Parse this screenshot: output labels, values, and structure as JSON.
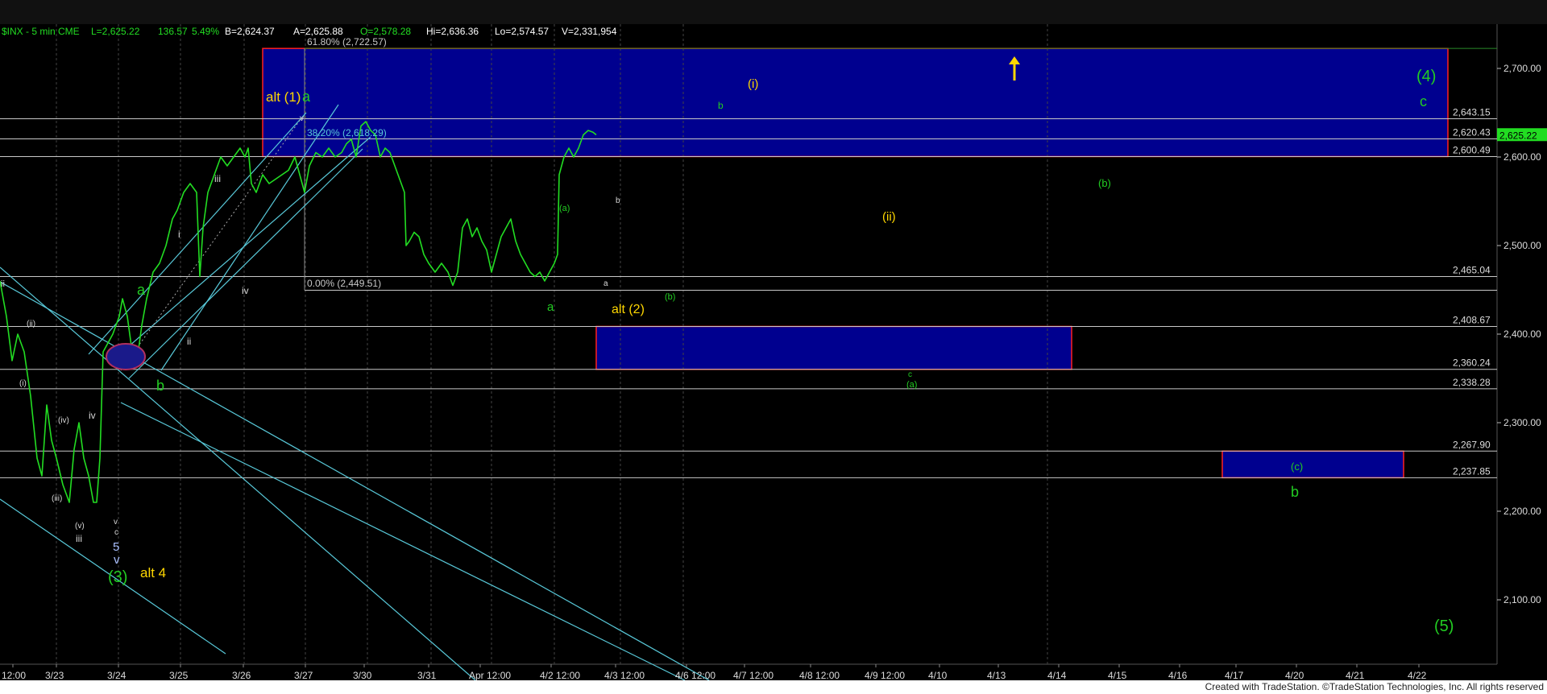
{
  "header": {
    "symbol": "$INX - 5 min  CME",
    "last": "L=2,625.22",
    "change": "136.57",
    "pct": "5.49%",
    "bid": "B=2,624.37",
    "ask": "A=2,625.88",
    "open": "O=2,578.28",
    "high": "Hi=2,636.36",
    "low": "Lo=2,574.57",
    "volume": "V=2,331,954"
  },
  "footer": {
    "credit": "Created with TradeStation. ©TradeStation Technologies, Inc. All rights reserved"
  },
  "colors": {
    "price": "#22dd22",
    "box_fill": "#00008f",
    "box_border": "#ff2020",
    "trendline": "#58c8d8",
    "hline": "#c8c8c8",
    "label_yellow": "#ffd700",
    "label_green": "#22cc22",
    "label_white": "#d8d8d8",
    "last_badge": "#22dd22"
  },
  "chart_data": {
    "type": "line",
    "series": [
      {
        "name": "",
        "note_points": [
          [
            0,
            2460
          ],
          [
            8,
            2420
          ],
          [
            15,
            2370
          ],
          [
            22,
            2400
          ],
          [
            30,
            2380
          ],
          [
            38,
            2330
          ],
          [
            46,
            2260
          ],
          [
            52,
            2240
          ],
          [
            58,
            2320
          ],
          [
            64,
            2280
          ],
          [
            70,
            2260
          ],
          [
            78,
            2230
          ],
          [
            86,
            2210
          ],
          [
            92,
            2270
          ],
          [
            98,
            2300
          ],
          [
            104,
            2260
          ],
          [
            110,
            2240
          ],
          [
            116,
            2210
          ],
          [
            120,
            2210
          ],
          [
            124,
            2260
          ],
          [
            128,
            2380
          ],
          [
            134,
            2390
          ],
          [
            140,
            2400
          ],
          [
            148,
            2420
          ],
          [
            152,
            2440
          ],
          [
            158,
            2420
          ],
          [
            164,
            2380
          ],
          [
            170,
            2370
          ],
          [
            176,
            2410
          ],
          [
            182,
            2440
          ],
          [
            190,
            2470
          ],
          [
            198,
            2480
          ],
          [
            206,
            2500
          ],
          [
            214,
            2530
          ],
          [
            220,
            2540
          ],
          [
            228,
            2560
          ],
          [
            236,
            2570
          ],
          [
            244,
            2560
          ],
          [
            248,
            2465
          ],
          [
            252,
            2520
          ],
          [
            258,
            2560
          ],
          [
            266,
            2580
          ],
          [
            274,
            2600
          ],
          [
            282,
            2590
          ],
          [
            290,
            2600
          ],
          [
            298,
            2610
          ],
          [
            304,
            2600
          ],
          [
            308,
            2610
          ],
          [
            312,
            2570
          ],
          [
            318,
            2560
          ],
          [
            326,
            2580
          ],
          [
            334,
            2570
          ],
          [
            342,
            2575
          ],
          [
            350,
            2580
          ],
          [
            358,
            2585
          ],
          [
            366,
            2600
          ],
          [
            372,
            2580
          ],
          [
            378,
            2560
          ],
          [
            384,
            2590
          ],
          [
            392,
            2605
          ],
          [
            400,
            2600
          ],
          [
            408,
            2610
          ],
          [
            416,
            2600
          ],
          [
            424,
            2605
          ],
          [
            430,
            2615
          ],
          [
            436,
            2620
          ],
          [
            442,
            2600
          ],
          [
            448,
            2635
          ],
          [
            454,
            2640
          ],
          [
            460,
            2630
          ],
          [
            466,
            2625
          ],
          [
            472,
            2600
          ],
          [
            478,
            2610
          ],
          [
            484,
            2605
          ],
          [
            490,
            2590
          ],
          [
            496,
            2575
          ],
          [
            502,
            2560
          ],
          [
            504,
            2500
          ],
          [
            508,
            2505
          ],
          [
            514,
            2515
          ],
          [
            520,
            2510
          ],
          [
            526,
            2490
          ],
          [
            532,
            2480
          ],
          [
            540,
            2470
          ],
          [
            548,
            2480
          ],
          [
            556,
            2470
          ],
          [
            562,
            2455
          ],
          [
            568,
            2470
          ],
          [
            574,
            2520
          ],
          [
            580,
            2530
          ],
          [
            586,
            2510
          ],
          [
            592,
            2520
          ],
          [
            598,
            2505
          ],
          [
            604,
            2495
          ],
          [
            610,
            2470
          ],
          [
            616,
            2490
          ],
          [
            622,
            2510
          ],
          [
            628,
            2520
          ],
          [
            634,
            2530
          ],
          [
            640,
            2505
          ],
          [
            646,
            2490
          ],
          [
            652,
            2480
          ],
          [
            658,
            2470
          ],
          [
            664,
            2465
          ],
          [
            670,
            2470
          ],
          [
            676,
            2460
          ],
          [
            682,
            2470
          ],
          [
            688,
            2480
          ],
          [
            692,
            2490
          ],
          [
            694,
            2580
          ],
          [
            700,
            2600
          ],
          [
            706,
            2610
          ],
          [
            712,
            2600
          ],
          [
            718,
            2610
          ],
          [
            724,
            2625
          ],
          [
            730,
            2630
          ],
          [
            736,
            2628
          ],
          [
            740,
            2625
          ]
        ]
      }
    ],
    "ylim": [
      2050,
      2735
    ],
    "y_ticks": [
      "2,700.00",
      "2,600.00",
      "2,500.00",
      "2,400.00",
      "2,300.00",
      "2,200.00",
      "2,100.00"
    ],
    "x_ticks": [
      "12:00",
      "3/23",
      "3/24",
      "3/25",
      "3/26",
      "3/27",
      "3/30",
      "3/31",
      "Apr 12:00",
      "4/2 12:00",
      "4/3 12:00",
      "4/6 12:00",
      "4/7 12:00",
      "4/8 12:00",
      "4/9 12:00",
      "4/10",
      "4/13",
      "4/14",
      "4/15",
      "4/16",
      "4/17",
      "4/20",
      "4/21",
      "4/22"
    ],
    "last_price": "2,625.22",
    "levels": [
      {
        "label": "2,643.15",
        "value": 2643.15
      },
      {
        "label": "2,620.43",
        "value": 2620.43
      },
      {
        "label": "2,600.49",
        "value": 2600.49
      },
      {
        "label": "2,465.04",
        "value": 2465.04
      },
      {
        "label": "2,408.67",
        "value": 2408.67
      },
      {
        "label": "2,360.24",
        "value": 2360.24
      },
      {
        "label": "2,338.28",
        "value": 2338.28
      },
      {
        "label": "2,267.90",
        "value": 2267.9
      },
      {
        "label": "2,237.85",
        "value": 2237.85
      }
    ],
    "fib_labels": {
      "f618": "61.80% (2,722.57)",
      "f382": "38.20% (2,618.29)",
      "f000": "0.00% (2,449.51)"
    },
    "annotations": {
      "alt1": "alt (1)",
      "a1": "a",
      "i_top": "(i)",
      "b_top": "b",
      "w4": "(4)",
      "c4": "c",
      "b_paren": "(b)",
      "ii": "(ii)",
      "a_paren_small": "(a)",
      "b_small": "b",
      "a_small": "a",
      "a_low": "a",
      "alt2": "alt (2)",
      "b_paren_low": "(b)",
      "c_small": "c",
      "a_paren_green": "(a)",
      "c_paren": "(c)",
      "b_big": "b",
      "w5": "(5)",
      "w3": "(3)",
      "alt4": "alt 4",
      "five": "5",
      "v_big": "v",
      "a_mid": "a",
      "b_mid": "b",
      "iii": "iii",
      "i_up": "i",
      "ii_up": "ii",
      "iv_up": "iv",
      "v_up": "v",
      "ii_left": "ii",
      "ii_paren": "(ii)",
      "i_paren": "(i)",
      "iv_paren": "(iv)",
      "iii_paren": "(iii)",
      "v_paren": "(v)",
      "iii_low": "iii",
      "iv_low": "iv",
      "v_low": "v",
      "c_low": "c"
    }
  }
}
